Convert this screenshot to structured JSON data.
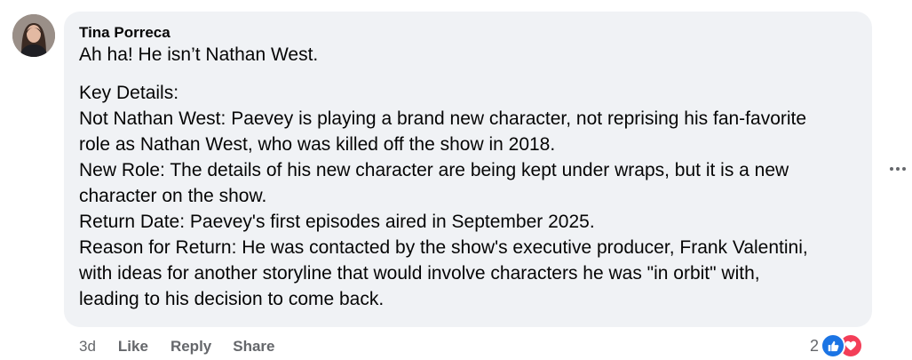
{
  "comment": {
    "author": "Tina Porreca",
    "first_line": "Ah ha! He isn’t Nathan West.",
    "lines": [
      "Key Details:",
      "Not Nathan West: Paevey is playing a brand new character, not reprising his fan-favorite",
      "role as Nathan West, who was killed off the show in 2018.",
      "New Role: The details of his new character are being kept under wraps, but it is a new",
      "character on the show.",
      "Return Date: Paevey's first episodes aired in September 2025.",
      "Reason for Return: He was contacted by the show's executive producer, Frank Valentini,",
      "with ideas for another storyline that would involve characters he was \"in orbit\" with,",
      "leading to his decision to come back."
    ]
  },
  "actions": {
    "time": "3d",
    "like": "Like",
    "reply": "Reply",
    "share": "Share"
  },
  "reactions": {
    "count": "2",
    "types": [
      "like-icon",
      "love-icon"
    ]
  },
  "icons": {
    "more": "more-horizontal-icon",
    "avatar": "avatar"
  },
  "colors": {
    "bubble": "#f0f2f5",
    "secondary_text": "#65676b",
    "like_blue": "#1b74e4",
    "love_red": "#f33e58"
  }
}
